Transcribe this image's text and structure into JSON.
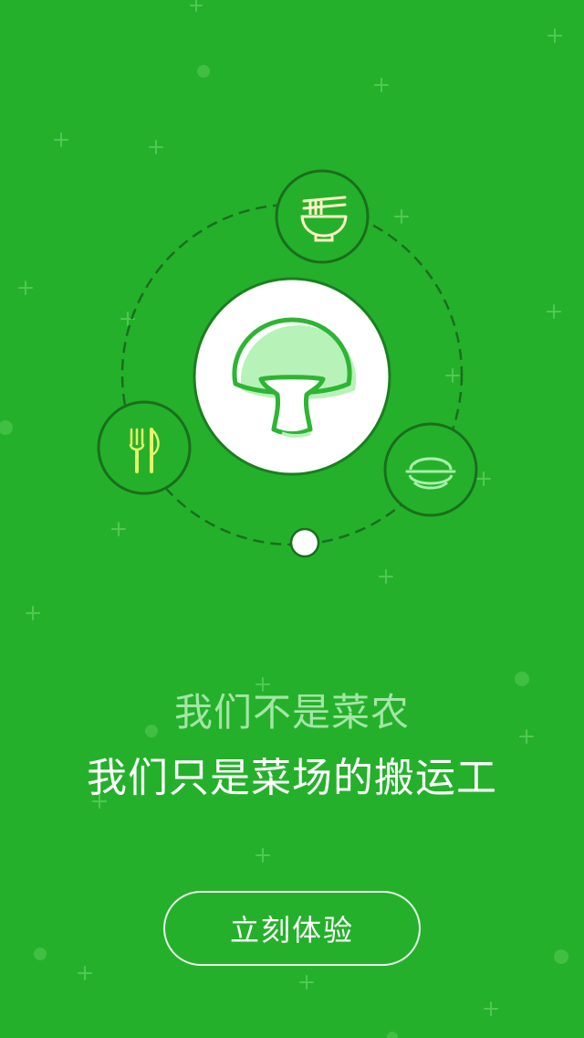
{
  "theme": {
    "background": "#25b02b",
    "accent_dark": "#1a7f1f",
    "accent_light": "#a8f0aa",
    "subtitle_color": "#a3e6a5",
    "fork_knife_color": "#e6f56a"
  },
  "illustration": {
    "center_icon": "mushroom-icon",
    "orbit_icons": [
      "noodle-bowl-icon",
      "fork-knife-icon",
      "dish-bowl-icon"
    ]
  },
  "headline": {
    "subtitle": "我们不是菜农",
    "title": "我们只是菜场的搬运工"
  },
  "cta": {
    "label": "立刻体验"
  }
}
